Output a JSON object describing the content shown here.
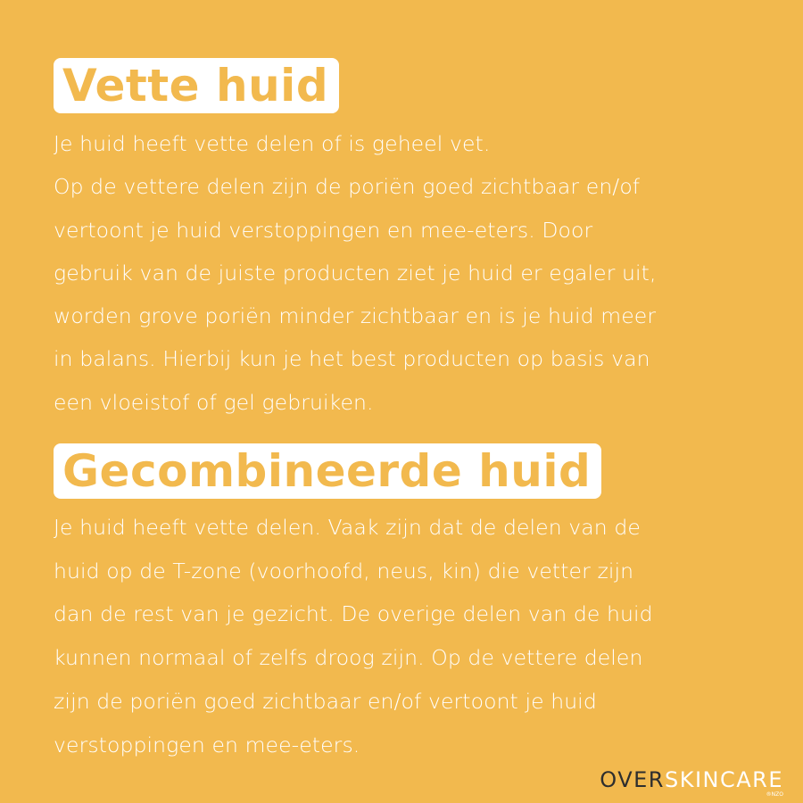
{
  "sections": [
    {
      "title": "Vette huid",
      "body": "Je huid heeft vette delen of is geheel vet.\nOp de vettere delen zijn de poriën goed zichtbaar en/of\nvertoont je huid verstoppingen en mee-eters. Door\ngebruik van de juiste producten ziet je huid er egaler uit,\nworden grove poriën minder zichtbaar en is je huid meer\nin balans. Hierbij kun je het best producten op basis van\neen vloeistof of gel gebruiken."
    },
    {
      "title": "Gecombineerde huid",
      "body": "Je huid heeft vette delen. Vaak zijn dat de delen van de\nhuid op de T-zone (voorhoofd, neus, kin) die vetter zijn\ndan de rest van je gezicht. De overige delen van de huid\nkunnen normaal of zelfs droog zijn. Op de vettere delen\nzijn de poriën goed zichtbaar en/of vertoont je huid\nverstoppingen en mee-eters."
    }
  ],
  "brand": {
    "part1": "OVER",
    "part2": "SKINCARE",
    "suffix": "®NZO"
  },
  "colors": {
    "background": "#f2b94e",
    "title_box": "#ffffff",
    "text": "#ffffff",
    "brand_dark": "#2e2e2e"
  }
}
